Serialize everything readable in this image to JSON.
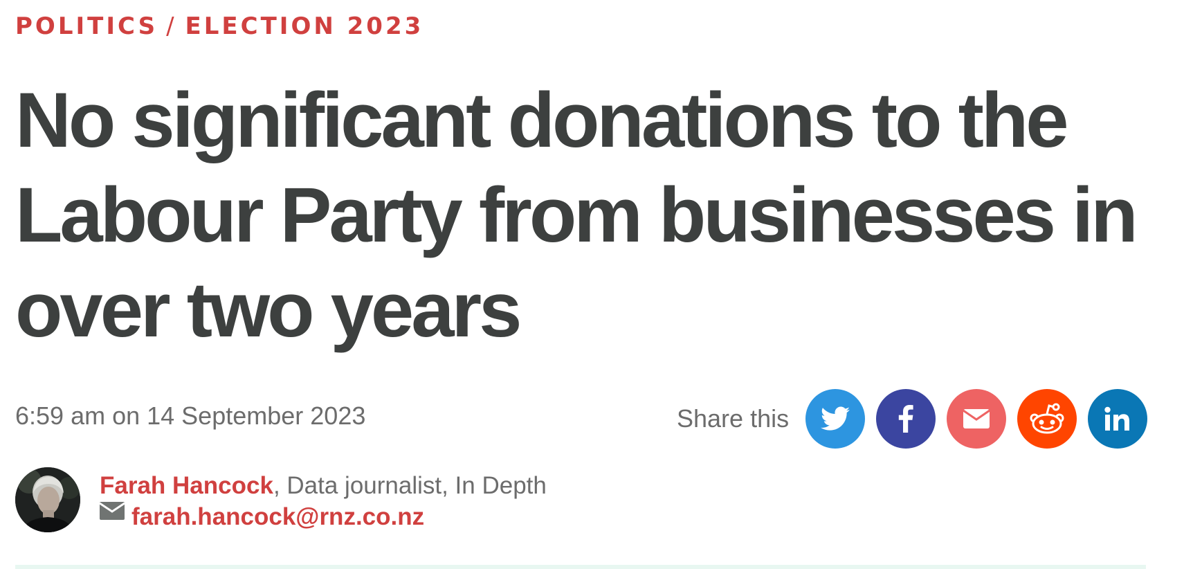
{
  "breadcrumb": {
    "section": "POLITICS",
    "separator": "/",
    "subsection": "ELECTION 2023"
  },
  "article": {
    "headline": "No significant donations to the Labour Party from businesses in over two years",
    "timestamp": "6:59 am on 14 September 2023"
  },
  "share": {
    "label": "Share this",
    "buttons": [
      {
        "name": "twitter",
        "icon": "twitter-icon",
        "color": "#2d95e0"
      },
      {
        "name": "facebook",
        "icon": "facebook-icon",
        "color": "#3b45a0"
      },
      {
        "name": "email",
        "icon": "envelope-icon",
        "color": "#ee6363"
      },
      {
        "name": "reddit",
        "icon": "reddit-icon",
        "color": "#ff4500"
      },
      {
        "name": "linkedin",
        "icon": "linkedin-icon",
        "color": "#0a77b5"
      }
    ]
  },
  "author": {
    "name": "Farah Hancock",
    "role": ", Data journalist, In Depth",
    "email": "farah.hancock@rnz.co.nz",
    "avatar_icon": "author-avatar"
  },
  "colors": {
    "accent": "#d0403f",
    "headline": "#3d403f",
    "meta": "#6c6c6c"
  }
}
